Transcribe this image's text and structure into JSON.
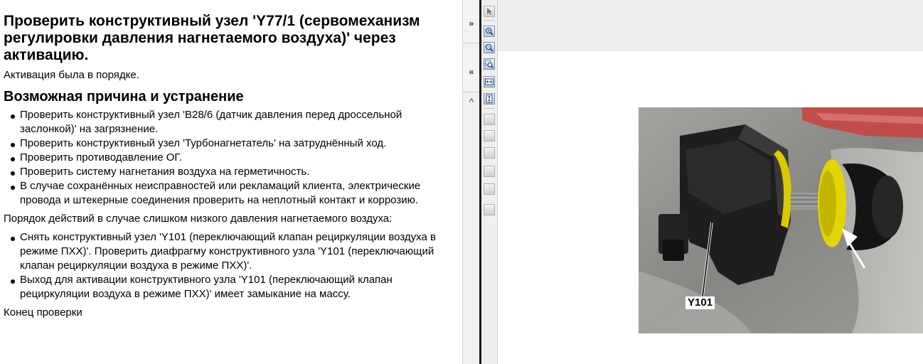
{
  "left_pane": {
    "title": "Проверить конструктивный узел 'Y77/1 (сервомеханизм регулировки давления нагнетаемого воздуха)' через активацию.",
    "activation_result": "Активация была в порядке.",
    "section_title": "Возможная причина и устранение",
    "causes": [
      "Проверить конструктивный узел 'B28/6 (датчик давления перед дроссельной заслонкой)' на загрязнение.",
      "Проверить конструктивный узел 'Турбонагнетатель' на затруднённый ход.",
      "Проверить противодавление ОГ.",
      "Проверить систему нагнетания воздуха на герметичность.",
      "В случае сохранённых неисправностей или рекламаций клиента, электрические провода и штекерные соединения проверить на неплотный контакт и коррозию."
    ],
    "low_pressure_intro": "Порядок действий в случае слишком низкого давления нагнетаемого воздуха:",
    "low_pressure_steps": [
      "Снять конструктивный узел 'Y101 (переключающий клапан рециркуляции воздуха в режиме ПХХ)'. Проверить диафрагму конструктивного узла 'Y101 (переключающий клапан рециркуляции воздуха в режиме ПХХ)'.",
      "Выход для активации конструктивного узла 'Y101 (переключающий клапан рециркуляции воздуха в режиме ПХХ)' имеет замыкание на массу."
    ],
    "end_text": "Конец проверки"
  },
  "splitter": {
    "expand_label": "»",
    "collapse_label": "«",
    "scroll_up_label": "^"
  },
  "toolbar": {
    "icons": [
      "select-tool-icon",
      "zoom-in-icon",
      "zoom-out-icon",
      "zoom-region-icon",
      "fit-width-icon",
      "fit-page-icon",
      "tool-7-icon",
      "tool-8-icon",
      "tool-9-icon",
      "tool-10-icon",
      "tool-11-icon",
      "tool-12-icon"
    ]
  },
  "image": {
    "label": "Y101"
  },
  "colors": {
    "divider": "#1a1a1a",
    "toolbar_bg": "#efefef",
    "viewer_top_bg": "#eeeeee",
    "diaphragm_yellow": "#e2d400"
  }
}
